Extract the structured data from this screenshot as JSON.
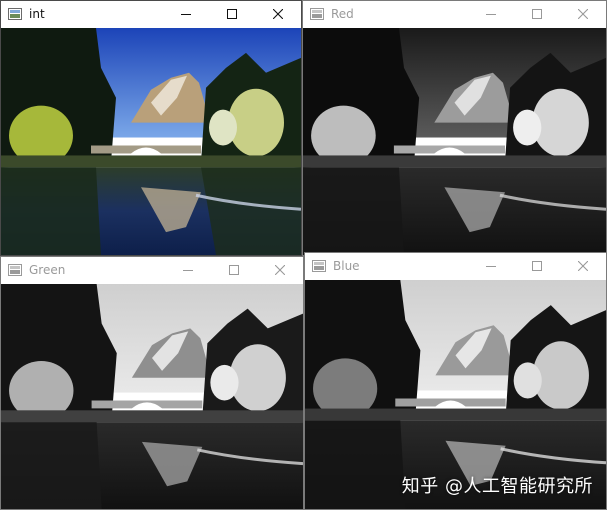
{
  "windows": [
    {
      "title": "int",
      "kind": "color",
      "active": true
    },
    {
      "title": "Red",
      "kind": "gray-red",
      "active": false
    },
    {
      "title": "Green",
      "kind": "gray-green",
      "active": false
    },
    {
      "title": "Blue",
      "kind": "gray-blue",
      "active": false
    }
  ],
  "watermark": {
    "text": "知乎 @人工智能研究所"
  },
  "icons": {
    "app": "opencv-window-icon",
    "minimize": "minimize-icon",
    "maximize": "maximize-icon",
    "close": "close-icon"
  }
}
